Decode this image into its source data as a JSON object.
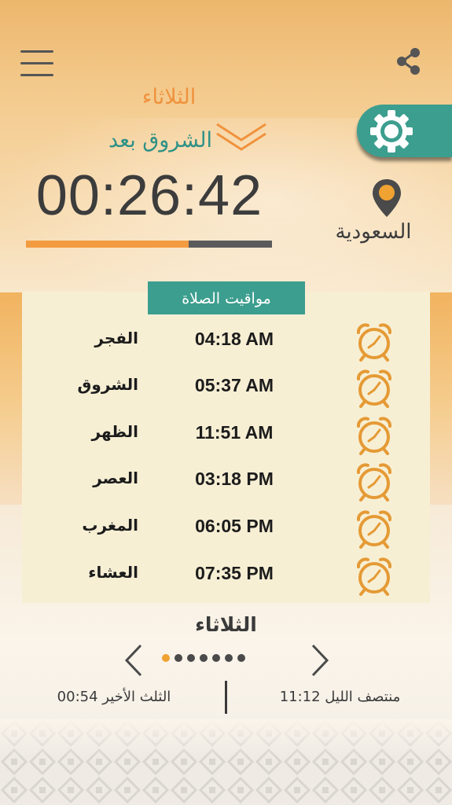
{
  "header": {
    "day": "الثلاثاء",
    "next_prayer_label": "الشروق بعد",
    "countdown": "00:26:42",
    "progress_fraction": 0.66
  },
  "location": {
    "name": "السعودية"
  },
  "icons": {
    "menu": "hamburger-menu-icon",
    "share": "share-icon",
    "settings": "gear-icon",
    "location": "location-pin-icon",
    "alarm": "alarm-clock-icon",
    "prev": "chevron-left-icon",
    "next": "chevron-right-icon",
    "chevrons": "double-chevron-down-icon"
  },
  "times": {
    "header": "مواقيت الصلاة",
    "prayers": [
      {
        "name": "الفجر",
        "time": "04:18 AM"
      },
      {
        "name": "الشروق",
        "time": "05:37 AM"
      },
      {
        "name": "الظهر",
        "time": "11:51 AM"
      },
      {
        "name": "العصر",
        "time": "03:18 PM"
      },
      {
        "name": "المغرب",
        "time": "06:05 PM"
      },
      {
        "name": "العشاء",
        "time": "07:35 PM"
      }
    ]
  },
  "footer": {
    "day": "الثلاثاء",
    "page_count": 7,
    "active_page": 1,
    "last_third": "الثلث الأخير 00:54",
    "midnight": "منتصف الليل 11:12"
  },
  "colors": {
    "accent_orange": "#f29b41",
    "teal": "#3c9e8e",
    "panel_bg": "#f7efd4",
    "dark_text": "#3c3c3c"
  }
}
